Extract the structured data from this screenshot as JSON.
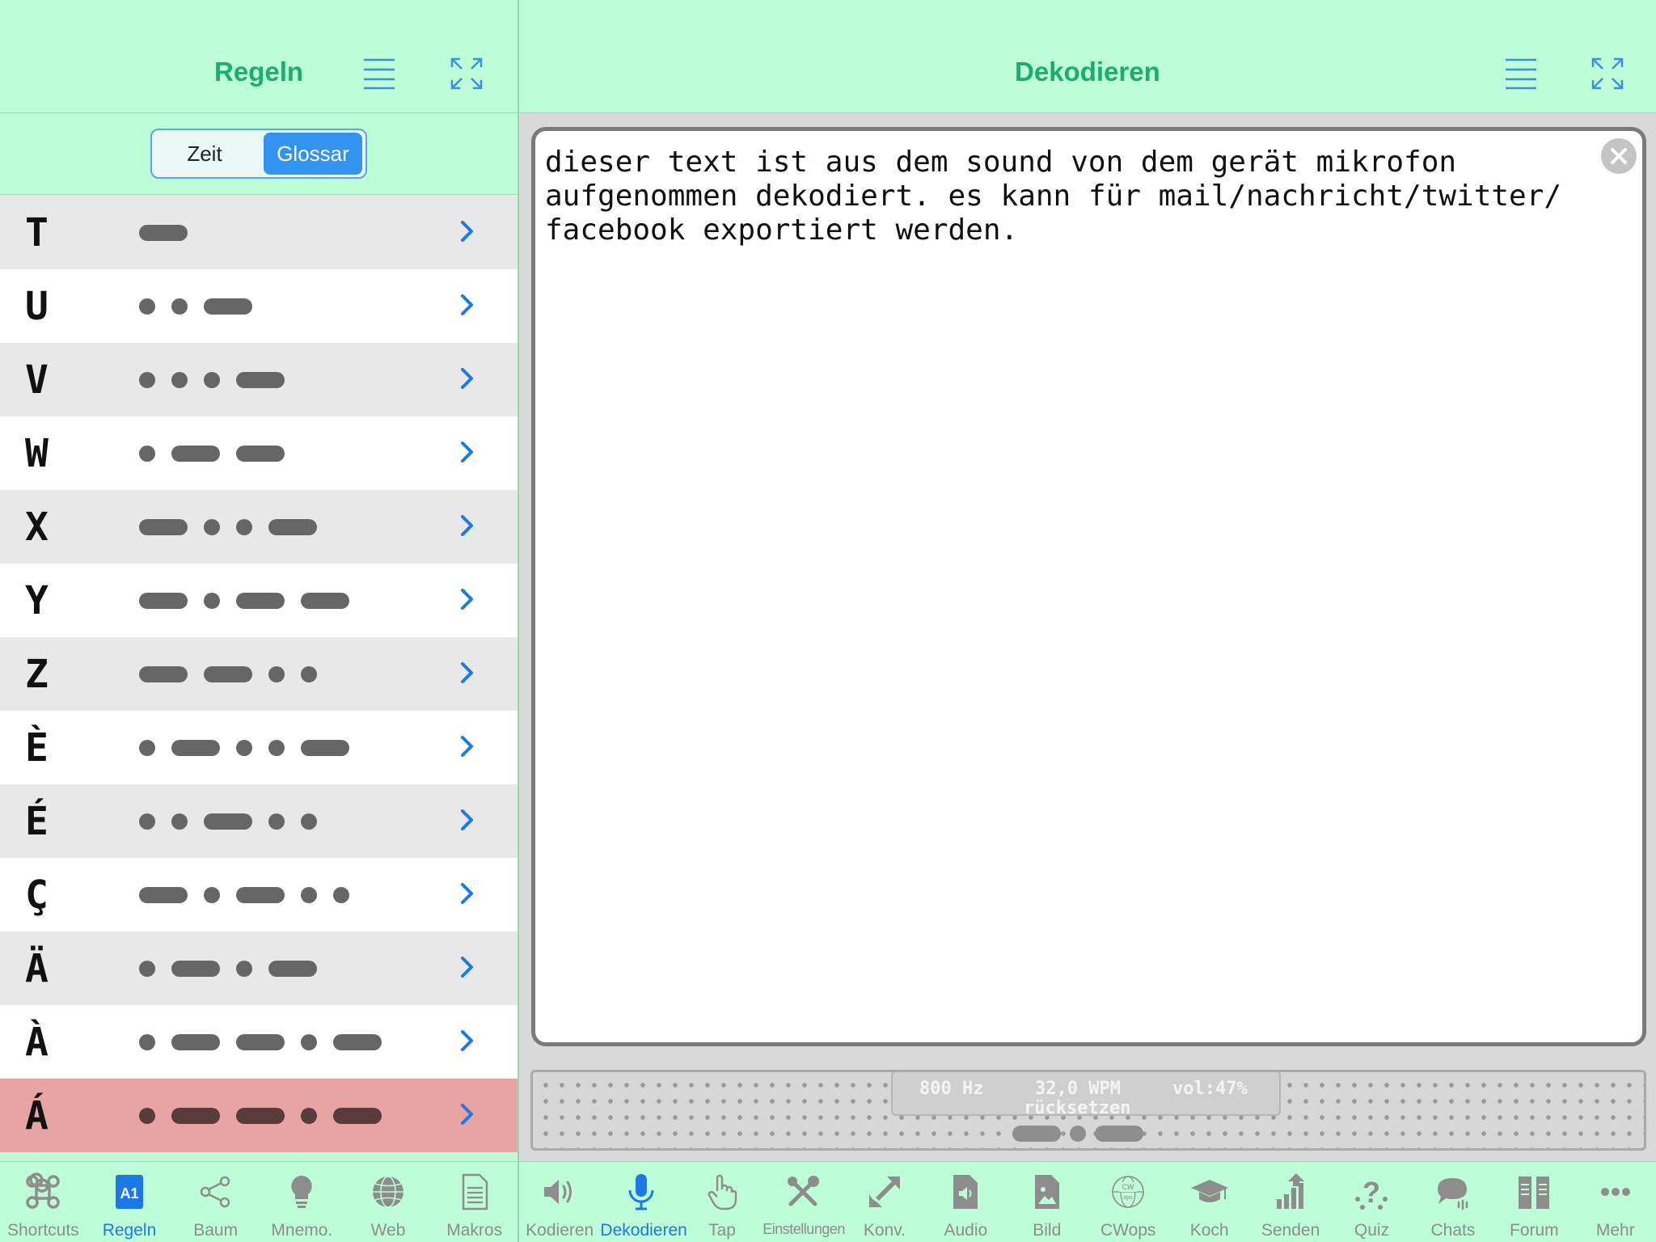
{
  "left": {
    "title": "Regeln",
    "segments": {
      "left": "Zeit",
      "right": "Glossar",
      "selected": "Glossar"
    },
    "rows": [
      {
        "letter": "T",
        "code": "-"
      },
      {
        "letter": "U",
        "code": "..-"
      },
      {
        "letter": "V",
        "code": "...-"
      },
      {
        "letter": "W",
        "code": ".--"
      },
      {
        "letter": "X",
        "code": "-..-"
      },
      {
        "letter": "Y",
        "code": "-.--"
      },
      {
        "letter": "Z",
        "code": "--.."
      },
      {
        "letter": "È",
        "code": ".-..-"
      },
      {
        "letter": "É",
        "code": "..-.."
      },
      {
        "letter": "Ç",
        "code": "-.-.."
      },
      {
        "letter": "Ä",
        "code": ".-.-"
      },
      {
        "letter": "À",
        "code": ".--.-"
      },
      {
        "letter": "Á",
        "code": ".--.-",
        "highlight": true
      }
    ]
  },
  "right": {
    "title": "Dekodieren",
    "decoded_text": "dieser text ist aus dem sound von dem gerät mikrofon\naufgenommen dekodiert. es kann für mail/nachricht/twitter/\nfacebook exportiert werden.",
    "scope": {
      "frequency": "800 Hz",
      "speed": "32,0 WPM",
      "volume": "vol:47%",
      "reset": "rücksetzen",
      "symbol": "-.-"
    }
  },
  "tabs_left": [
    {
      "label": "Shortcuts",
      "icon": "command-icon"
    },
    {
      "label": "Regeln",
      "icon": "rules-icon",
      "active": true
    },
    {
      "label": "Baum",
      "icon": "tree-icon"
    },
    {
      "label": "Mnemo.",
      "icon": "lightbulb-icon"
    },
    {
      "label": "Web",
      "icon": "globe-icon"
    },
    {
      "label": "Makros",
      "icon": "document-icon"
    }
  ],
  "tabs_right": [
    {
      "label": "Kodieren",
      "icon": "speaker-icon"
    },
    {
      "label": "Dekodieren",
      "icon": "microphone-icon",
      "active": true
    },
    {
      "label": "Tap",
      "icon": "hand-tap-icon"
    },
    {
      "label": "Einstellungen",
      "icon": "tools-icon"
    },
    {
      "label": "Konv.",
      "icon": "convert-icon"
    },
    {
      "label": "Audio",
      "icon": "audio-file-icon"
    },
    {
      "label": "Bild",
      "icon": "image-file-icon"
    },
    {
      "label": "CWops",
      "icon": "cwops-icon"
    },
    {
      "label": "Koch",
      "icon": "graduation-cap-icon"
    },
    {
      "label": "Senden",
      "icon": "send-chart-icon"
    },
    {
      "label": "Quiz",
      "icon": "quiz-icon"
    },
    {
      "label": "Chats",
      "icon": "chat-icon"
    },
    {
      "label": "Forum",
      "icon": "forum-icon"
    },
    {
      "label": "Mehr",
      "icon": "more-icon"
    }
  ],
  "colors": {
    "mint_background": "#bdfdd8",
    "title_green": "#1aae6f",
    "accent_blue": "#1b79e8",
    "row_gray": "#e8e8e8",
    "row_white": "#ffffff",
    "row_highlight": "#e8a3a3",
    "tab_gray": "#8d8d8d"
  }
}
